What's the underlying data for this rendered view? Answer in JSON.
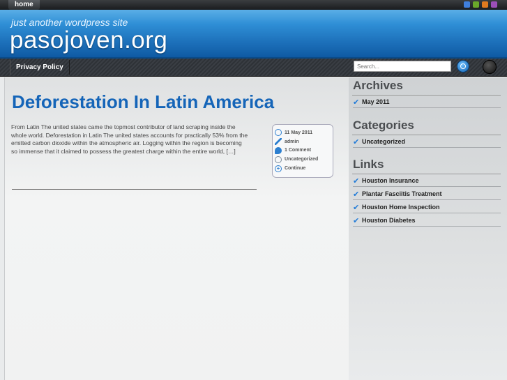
{
  "topbar": {
    "home_label": "home"
  },
  "header": {
    "tagline": "just another wordpress site",
    "site_title": "pasojoven.org"
  },
  "nav": {
    "items": [
      {
        "label": "Privacy Policy"
      }
    ],
    "search_placeholder": "Search..."
  },
  "post": {
    "title": "Deforestation In Latin America",
    "excerpt": "From Latin The united states came the topmost contributor of land scraping inside the whole world. Deforestation in Latin The united states accounts for practically 53% from the emitted carbon dioxide within the atmospheric air. Logging within the region is becoming so immense that it claimed to possess the greatest charge within the entire world, […]",
    "meta": {
      "date": "11 May 2011",
      "author": "admin",
      "comments": "1 Comment",
      "category": "Uncategorized",
      "continue": "Continue"
    }
  },
  "sidebar": {
    "archives": {
      "title": "Archives",
      "items": [
        "May 2011"
      ]
    },
    "categories": {
      "title": "Categories",
      "items": [
        "Uncategorized"
      ]
    },
    "links": {
      "title": "Links",
      "items": [
        "Houston Insurance",
        "Plantar Fasciitis Treatment",
        "Houston Home Inspection",
        "Houston Diabetes"
      ]
    }
  },
  "colors": {
    "accent": "#1565b8",
    "header_blue": "#2f8fd6",
    "nav_dark": "#2e3237"
  }
}
